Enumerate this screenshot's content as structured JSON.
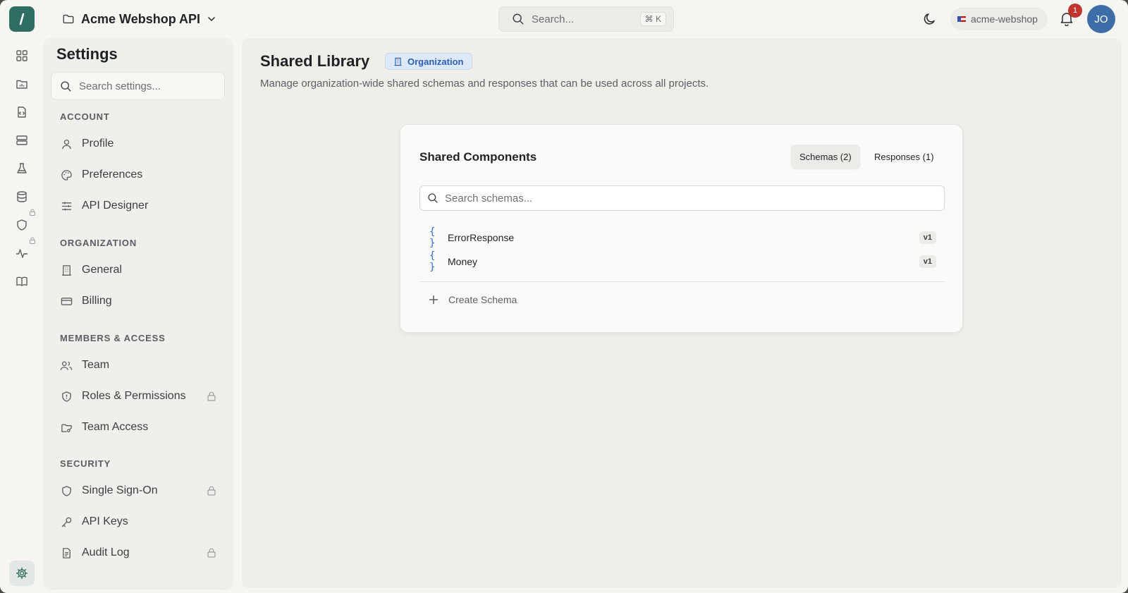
{
  "app": {
    "project_name": "Acme Webshop API",
    "brand_color": "#2f6f63"
  },
  "topbar": {
    "search_placeholder": "Search...",
    "search_shortcut": "⌘ K",
    "org_slug": "acme-webshop",
    "notification_count": "1",
    "avatar_initials": "JO"
  },
  "rail": {
    "icons": [
      "dashboard-icon",
      "folder-chart-icon",
      "code-file-icon",
      "server-icon",
      "flask-icon",
      "database-icon",
      "shield-icon",
      "activity-icon",
      "book-icon",
      "gear-icon"
    ]
  },
  "settings": {
    "title": "Settings",
    "search_placeholder": "Search settings...",
    "sections": [
      {
        "label": "ACCOUNT",
        "items": [
          {
            "label": "Profile",
            "icon": "user-icon",
            "locked": false
          },
          {
            "label": "Preferences",
            "icon": "palette-icon",
            "locked": false
          },
          {
            "label": "API Designer",
            "icon": "sliders-icon",
            "locked": false
          }
        ]
      },
      {
        "label": "ORGANIZATION",
        "items": [
          {
            "label": "General",
            "icon": "building-icon",
            "locked": false
          },
          {
            "label": "Billing",
            "icon": "credit-card-icon",
            "locked": false
          }
        ]
      },
      {
        "label": "MEMBERS & ACCESS",
        "items": [
          {
            "label": "Team",
            "icon": "users-icon",
            "locked": false
          },
          {
            "label": "Roles & Permissions",
            "icon": "shield-icon",
            "locked": true
          },
          {
            "label": "Team Access",
            "icon": "folder-key-icon",
            "locked": false
          }
        ]
      },
      {
        "label": "SECURITY",
        "items": [
          {
            "label": "Single Sign-On",
            "icon": "shield-icon",
            "locked": true
          },
          {
            "label": "API Keys",
            "icon": "key-icon",
            "locked": false
          },
          {
            "label": "Audit Log",
            "icon": "document-icon",
            "locked": true
          }
        ]
      }
    ]
  },
  "main": {
    "title": "Shared Library",
    "badge": "Organization",
    "description": "Manage organization-wide shared schemas and responses that can be used across all projects.",
    "card": {
      "title": "Shared Components",
      "tabs": [
        {
          "label": "Schemas (2)",
          "active": true
        },
        {
          "label": "Responses (1)",
          "active": false
        }
      ],
      "search_placeholder": "Search schemas...",
      "schemas": [
        {
          "name": "ErrorResponse",
          "version": "v1"
        },
        {
          "name": "Money",
          "version": "v1"
        }
      ],
      "create_label": "Create Schema"
    }
  }
}
